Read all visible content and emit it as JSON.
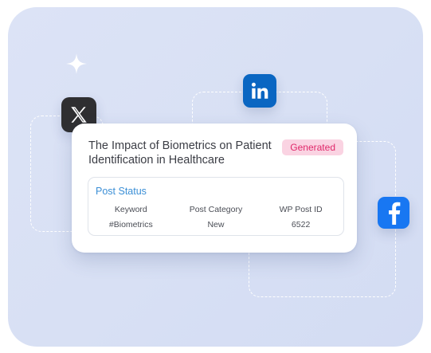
{
  "post": {
    "title": "The Impact of Biometrics on Patient Identification in Healthcare",
    "badge": "Generated"
  },
  "status": {
    "heading": "Post Status",
    "columns": [
      {
        "header": "Keyword",
        "value": "#Biometrics"
      },
      {
        "header": "Post Category",
        "value": "New"
      },
      {
        "header": "WP Post ID",
        "value": "6522"
      }
    ]
  },
  "social_icons": [
    "x-icon",
    "linkedin-icon",
    "facebook-icon"
  ],
  "colors": {
    "panel_bg": "#d9e1f5",
    "badge_bg": "#fad3e2",
    "badge_text": "#e0286a",
    "link_blue": "#3b8fd6",
    "linkedin": "#0a66c2",
    "facebook": "#1877f2",
    "x": "#2f2f31"
  }
}
